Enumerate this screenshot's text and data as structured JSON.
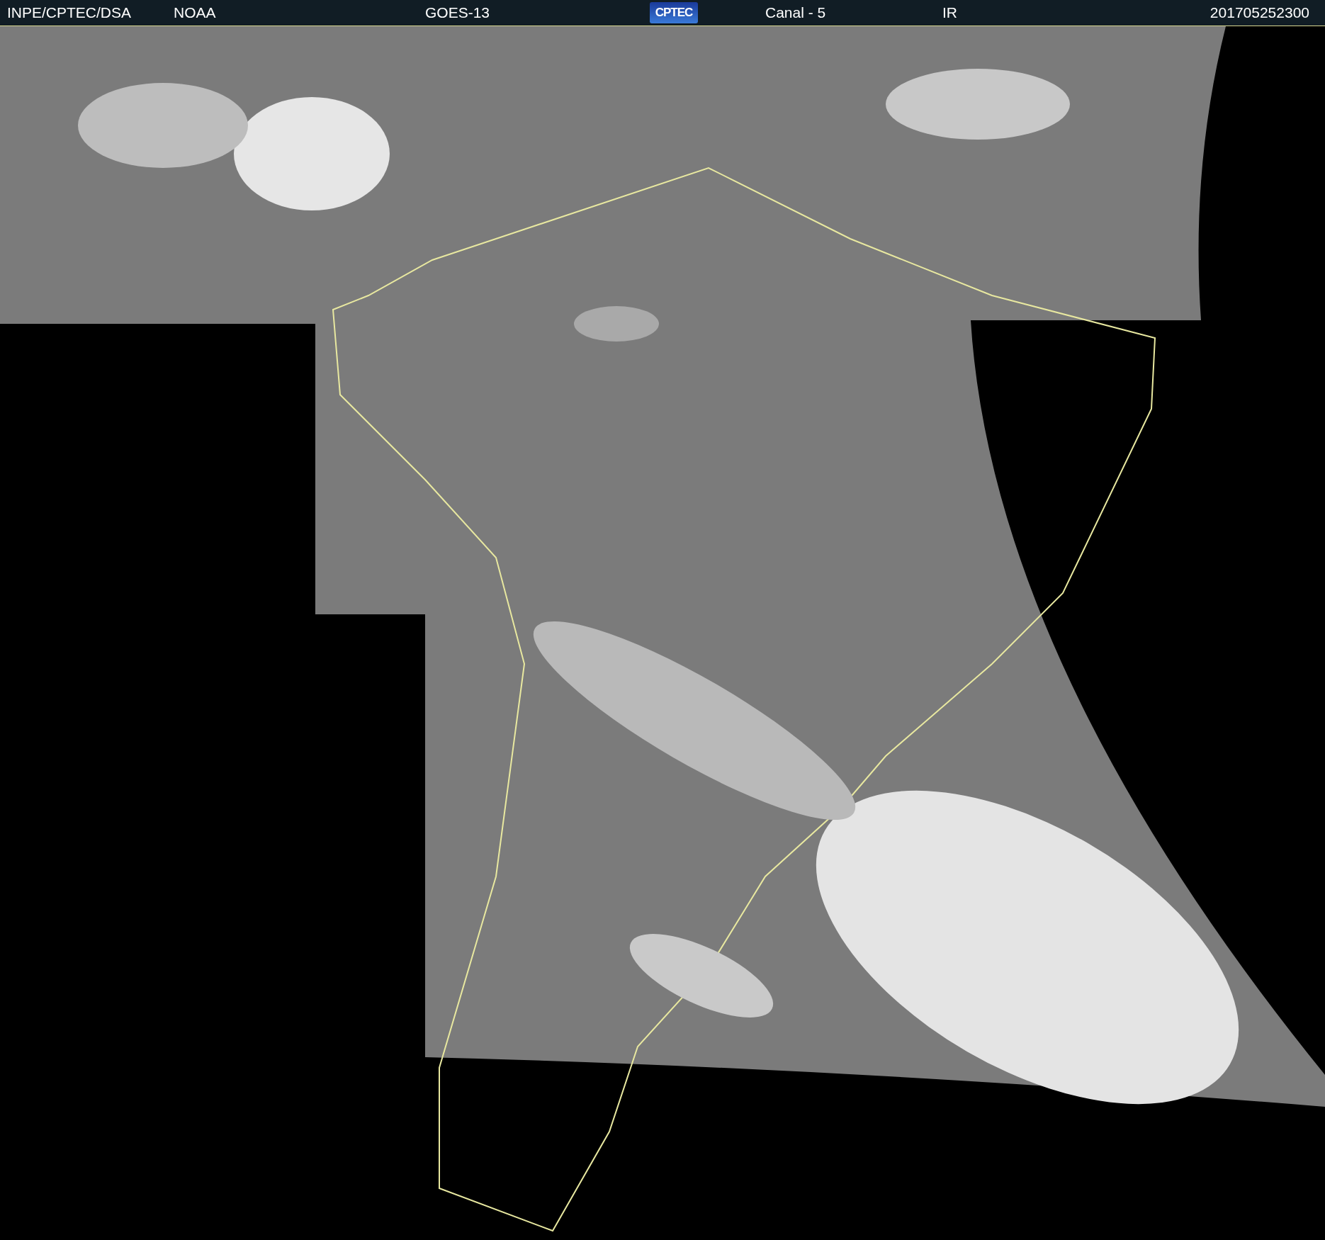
{
  "header": {
    "labels": [
      "INPE/CPTEC/DSA",
      "NOAA",
      "GOES-13"
    ],
    "logo": "CPTEC",
    "channel": "Canal - 5",
    "band": "IR",
    "timestamp": "201705252300"
  }
}
